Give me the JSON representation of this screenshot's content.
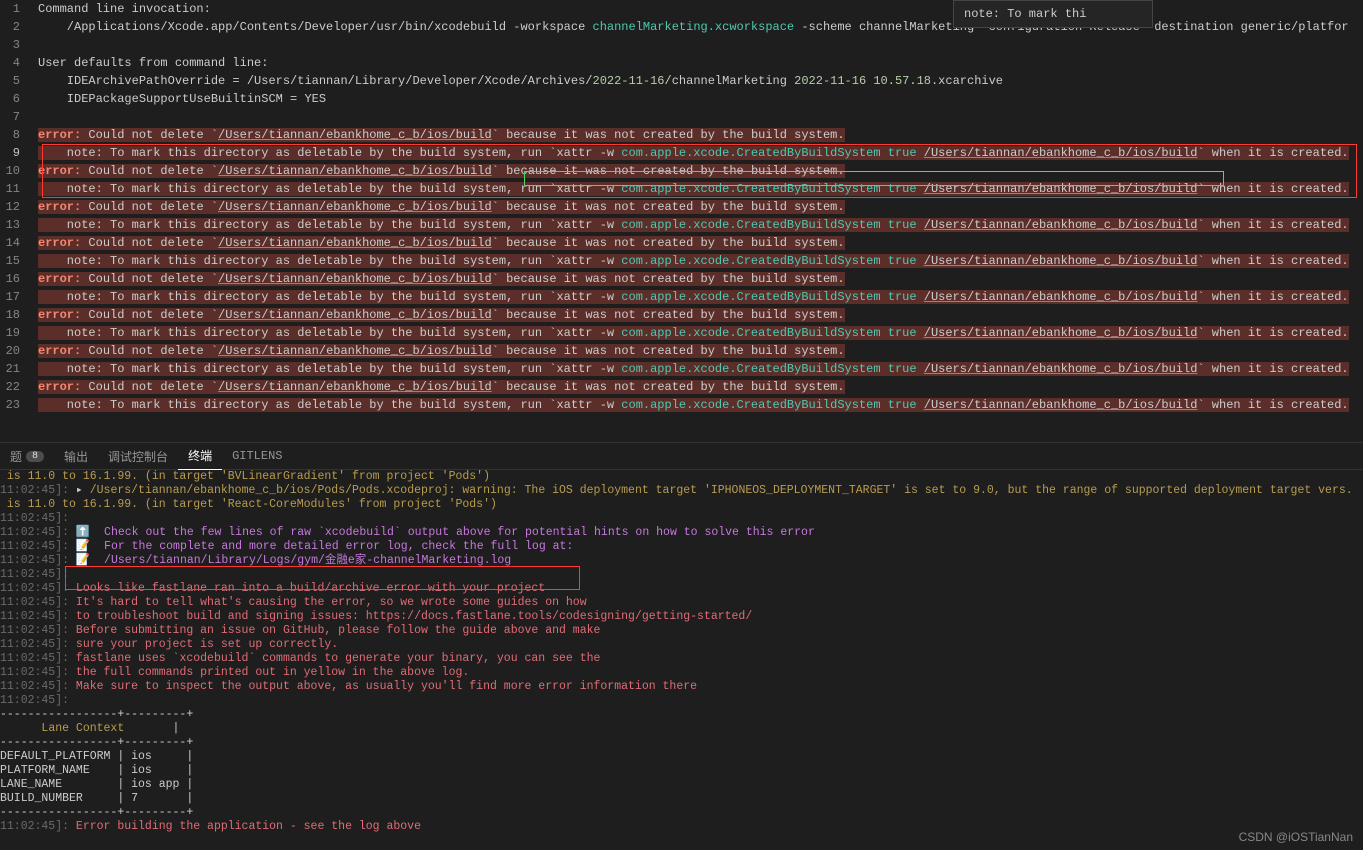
{
  "hover": {
    "text": "    note: To mark thi"
  },
  "editor": {
    "lines": [
      {
        "n": 1,
        "text": "Command line invocation:"
      },
      {
        "n": 2,
        "segs": [
          {
            "t": "    /Applications/Xcode.app/Contents/Developer/usr/bin/xcodebuild -workspace "
          },
          {
            "t": "channelMarketing.xcworkspace",
            "cls": "w-cyan"
          },
          {
            "t": " -scheme channelMarketing -configuration Release -destination generic/platfor"
          }
        ]
      },
      {
        "n": 3,
        "text": ""
      },
      {
        "n": 4,
        "text": "User defaults from command line:"
      },
      {
        "n": 5,
        "segs": [
          {
            "t": "    IDEArchivePathOverride = /Users/tiannan/Library/Developer/Xcode/Archives/"
          },
          {
            "t": "2022-11-16",
            "cls": "w-num"
          },
          {
            "t": "/channelMarketing "
          },
          {
            "t": "2022-11-16",
            "cls": "w-num"
          },
          {
            "t": " "
          },
          {
            "t": "10",
            "cls": "w-num"
          },
          {
            "t": "."
          },
          {
            "t": "57",
            "cls": "w-num"
          },
          {
            "t": "."
          },
          {
            "t": "18",
            "cls": "w-num"
          },
          {
            "t": ".xcarchive"
          }
        ]
      },
      {
        "n": 6,
        "text": "    IDEPackageSupportUseBuiltinSCM = YES"
      },
      {
        "n": 7,
        "text": ""
      },
      {
        "n": 8,
        "hl": true,
        "segs": [
          {
            "t": "error:",
            "cls": "err-word"
          },
          {
            "t": " Could not delete `"
          },
          {
            "t": "/Users/tiannan/ebankhome_c_b/ios/build",
            "cls": "underline"
          },
          {
            "t": "` because it was not created by the build system."
          }
        ]
      },
      {
        "n": 9,
        "active": true,
        "hl": true,
        "segs": [
          {
            "t": "    note: To mark this directory as deletable by the build system, run `xattr -w "
          },
          {
            "t": "com.apple.xcode.CreatedByBuildSystem true",
            "cls": "w-cyan"
          },
          {
            "t": " "
          },
          {
            "t": "/Users/tiannan/ebankhome_c_b/ios/build",
            "cls": "underline"
          },
          {
            "t": "` when it is created."
          }
        ]
      },
      {
        "n": 10,
        "hl": true,
        "segs": [
          {
            "t": "error:",
            "cls": "err-word"
          },
          {
            "t": " Could not delete `"
          },
          {
            "t": "/Users/tiannan/ebankhome_c_b/ios/build",
            "cls": "underline"
          },
          {
            "t": "` because it was not created by the build system."
          }
        ]
      },
      {
        "n": 11,
        "hl": true,
        "segs": [
          {
            "t": "    note: To mark this directory as deletable by the build system, run `xattr -w "
          },
          {
            "t": "com.apple.xcode.CreatedByBuildSystem true",
            "cls": "w-cyan"
          },
          {
            "t": " "
          },
          {
            "t": "/Users/tiannan/ebankhome_c_b/ios/build",
            "cls": "underline"
          },
          {
            "t": "` when it is created."
          }
        ]
      },
      {
        "n": 12,
        "hl": true,
        "segs": [
          {
            "t": "error:",
            "cls": "err-word"
          },
          {
            "t": " Could not delete `"
          },
          {
            "t": "/Users/tiannan/ebankhome_c_b/ios/build",
            "cls": "underline"
          },
          {
            "t": "` because it was not created by the build system."
          }
        ]
      },
      {
        "n": 13,
        "hl": true,
        "segs": [
          {
            "t": "    note: To mark this directory as deletable by the build system, run `xattr -w "
          },
          {
            "t": "com.apple.xcode.CreatedByBuildSystem true",
            "cls": "w-cyan"
          },
          {
            "t": " "
          },
          {
            "t": "/Users/tiannan/ebankhome_c_b/ios/build",
            "cls": "underline"
          },
          {
            "t": "` when it is created."
          }
        ]
      },
      {
        "n": 14,
        "hl": true,
        "segs": [
          {
            "t": "error:",
            "cls": "err-word"
          },
          {
            "t": " Could not delete `"
          },
          {
            "t": "/Users/tiannan/ebankhome_c_b/ios/build",
            "cls": "underline"
          },
          {
            "t": "` because it was not created by the build system."
          }
        ]
      },
      {
        "n": 15,
        "hl": true,
        "segs": [
          {
            "t": "    note: To mark this directory as deletable by the build system, run `xattr -w "
          },
          {
            "t": "com.apple.xcode.CreatedByBuildSystem true",
            "cls": "w-cyan"
          },
          {
            "t": " "
          },
          {
            "t": "/Users/tiannan/ebankhome_c_b/ios/build",
            "cls": "underline"
          },
          {
            "t": "` when it is created."
          }
        ]
      },
      {
        "n": 16,
        "hl": true,
        "segs": [
          {
            "t": "error:",
            "cls": "err-word"
          },
          {
            "t": " Could not delete `"
          },
          {
            "t": "/Users/tiannan/ebankhome_c_b/ios/build",
            "cls": "underline"
          },
          {
            "t": "` because it was not created by the build system."
          }
        ]
      },
      {
        "n": 17,
        "hl": true,
        "segs": [
          {
            "t": "    note: To mark this directory as deletable by the build system, run `xattr -w "
          },
          {
            "t": "com.apple.xcode.CreatedByBuildSystem true",
            "cls": "w-cyan"
          },
          {
            "t": " "
          },
          {
            "t": "/Users/tiannan/ebankhome_c_b/ios/build",
            "cls": "underline"
          },
          {
            "t": "` when it is created."
          }
        ]
      },
      {
        "n": 18,
        "hl": true,
        "segs": [
          {
            "t": "error:",
            "cls": "err-word"
          },
          {
            "t": " Could not delete `"
          },
          {
            "t": "/Users/tiannan/ebankhome_c_b/ios/build",
            "cls": "underline"
          },
          {
            "t": "` because it was not created by the build system."
          }
        ]
      },
      {
        "n": 19,
        "hl": true,
        "segs": [
          {
            "t": "    note: To mark this directory as deletable by the build system, run `xattr -w "
          },
          {
            "t": "com.apple.xcode.CreatedByBuildSystem true",
            "cls": "w-cyan"
          },
          {
            "t": " "
          },
          {
            "t": "/Users/tiannan/ebankhome_c_b/ios/build",
            "cls": "underline"
          },
          {
            "t": "` when it is created."
          }
        ]
      },
      {
        "n": 20,
        "hl": true,
        "segs": [
          {
            "t": "error:",
            "cls": "err-word"
          },
          {
            "t": " Could not delete `"
          },
          {
            "t": "/Users/tiannan/ebankhome_c_b/ios/build",
            "cls": "underline"
          },
          {
            "t": "` because it was not created by the build system."
          }
        ]
      },
      {
        "n": 21,
        "hl": true,
        "segs": [
          {
            "t": "    note: To mark this directory as deletable by the build system, run `xattr -w "
          },
          {
            "t": "com.apple.xcode.CreatedByBuildSystem true",
            "cls": "w-cyan"
          },
          {
            "t": " "
          },
          {
            "t": "/Users/tiannan/ebankhome_c_b/ios/build",
            "cls": "underline"
          },
          {
            "t": "` when it is created."
          }
        ]
      },
      {
        "n": 22,
        "hl": true,
        "segs": [
          {
            "t": "error:",
            "cls": "err-word"
          },
          {
            "t": " Could not delete `"
          },
          {
            "t": "/Users/tiannan/ebankhome_c_b/ios/build",
            "cls": "underline"
          },
          {
            "t": "` because it was not created by the build system."
          }
        ]
      },
      {
        "n": 23,
        "hl": true,
        "segs": [
          {
            "t": "    note: To mark this directory as deletable by the build system, run `xattr -w "
          },
          {
            "t": "com.apple.xcode.CreatedByBuildSystem true",
            "cls": "w-cyan"
          },
          {
            "t": " "
          },
          {
            "t": "/Users/tiannan/ebankhome_c_b/ios/build",
            "cls": "underline"
          },
          {
            "t": "` when it is created."
          }
        ]
      }
    ]
  },
  "tabs": {
    "problems": {
      "label": "题",
      "badge": "8"
    },
    "output": {
      "label": "输出"
    },
    "debug": {
      "label": "调试控制台"
    },
    "terminal": {
      "label": "终端"
    },
    "gitlens": {
      "label": "GITLENS"
    }
  },
  "terminal": {
    "lines": [
      {
        "segs": [
          {
            "t": " is 11.0 to 16.1.99. (in target 'BVLinearGradient' from project 'Pods')",
            "cls": "term-yellow"
          }
        ]
      },
      {
        "segs": [
          {
            "t": "11:02:45]: ",
            "cls": "term-gray"
          },
          {
            "t": "▸ ",
            "cls": "term-white"
          },
          {
            "t": "/Users/tiannan/ebankhome_c_b/ios/Pods/Pods.xcodeproj: warning: The iOS deployment target 'IPHONEOS_DEPLOYMENT_TARGET' is set to 9.0, but the range of supported deployment target vers.",
            "cls": "term-yellow"
          }
        ]
      },
      {
        "segs": [
          {
            "t": " is 11.0 to 16.1.99. (in target 'React-CoreModules' from project 'Pods')",
            "cls": "term-yellow"
          }
        ]
      },
      {
        "segs": [
          {
            "t": "11:02:45]:",
            "cls": "term-gray"
          }
        ]
      },
      {
        "segs": [
          {
            "t": "11:02:45]: ",
            "cls": "term-gray"
          },
          {
            "t": "⬆️  ",
            "cls": "term-white"
          },
          {
            "t": "Check out the few lines of raw `xcodebuild` output above for potential hints on how to solve this error",
            "cls": "term-pink"
          }
        ]
      },
      {
        "segs": [
          {
            "t": "11:02:45]: ",
            "cls": "term-gray"
          },
          {
            "t": "📝  ",
            "cls": "term-white"
          },
          {
            "t": "For the complete and more detailed error log, check the full log at:",
            "cls": "term-pink"
          }
        ]
      },
      {
        "segs": [
          {
            "t": "11:02:45]: ",
            "cls": "term-gray"
          },
          {
            "t": "📝  ",
            "cls": "term-white"
          },
          {
            "t": "/Users/tiannan/Library/Logs/gym/金融e家-channelMarketing.log",
            "cls": "term-pink"
          }
        ]
      },
      {
        "segs": [
          {
            "t": "11:02:45]:",
            "cls": "term-gray"
          }
        ]
      },
      {
        "segs": [
          {
            "t": "11:02:45]: ",
            "cls": "term-gray"
          },
          {
            "t": "Looks like fastlane ran into a build/archive error with your project",
            "cls": "term-red"
          }
        ]
      },
      {
        "segs": [
          {
            "t": "11:02:45]: ",
            "cls": "term-gray"
          },
          {
            "t": "It's hard to tell what's causing the error, so we wrote some guides on how",
            "cls": "term-red"
          }
        ]
      },
      {
        "segs": [
          {
            "t": "11:02:45]: ",
            "cls": "term-gray"
          },
          {
            "t": "to troubleshoot build and signing issues: https://docs.fastlane.tools/codesigning/getting-started/",
            "cls": "term-red"
          }
        ]
      },
      {
        "segs": [
          {
            "t": "11:02:45]: ",
            "cls": "term-gray"
          },
          {
            "t": "Before submitting an issue on GitHub, please follow the guide above and make",
            "cls": "term-red"
          }
        ]
      },
      {
        "segs": [
          {
            "t": "11:02:45]: ",
            "cls": "term-gray"
          },
          {
            "t": "sure your project is set up correctly.",
            "cls": "term-red"
          }
        ]
      },
      {
        "segs": [
          {
            "t": "11:02:45]: ",
            "cls": "term-gray"
          },
          {
            "t": "fastlane uses `xcodebuild` commands to generate your binary, you can see the",
            "cls": "term-red"
          }
        ]
      },
      {
        "segs": [
          {
            "t": "11:02:45]: ",
            "cls": "term-gray"
          },
          {
            "t": "the full commands printed out in yellow in the above log.",
            "cls": "term-red"
          }
        ]
      },
      {
        "segs": [
          {
            "t": "11:02:45]: ",
            "cls": "term-gray"
          },
          {
            "t": "Make sure to inspect the output above, as usually you'll find more error information there",
            "cls": "term-red"
          }
        ]
      },
      {
        "segs": [
          {
            "t": "11:02:45]:",
            "cls": "term-gray"
          }
        ]
      },
      {
        "segs": [
          {
            "t": "-----------------+---------+",
            "cls": "term-white"
          }
        ]
      },
      {
        "segs": [
          {
            "t": "      ",
            "cls": "term-white"
          },
          {
            "t": "Lane Context",
            "cls": "term-yellow"
          },
          {
            "t": "       |",
            "cls": "term-white"
          }
        ]
      },
      {
        "segs": [
          {
            "t": "-----------------+---------+",
            "cls": "term-white"
          }
        ]
      },
      {
        "segs": [
          {
            "t": "DEFAULT_PLATFORM | ios     |",
            "cls": "term-white"
          }
        ]
      },
      {
        "segs": [
          {
            "t": "PLATFORM_NAME    | ios     |",
            "cls": "term-white"
          }
        ]
      },
      {
        "segs": [
          {
            "t": "LANE_NAME        | ios app |",
            "cls": "term-white"
          }
        ]
      },
      {
        "segs": [
          {
            "t": "BUILD_NUMBER     | 7       |",
            "cls": "term-white"
          }
        ]
      },
      {
        "segs": [
          {
            "t": "-----------------+---------+",
            "cls": "term-white"
          }
        ]
      },
      {
        "segs": [
          {
            "t": "",
            "cls": "term-white"
          }
        ]
      },
      {
        "segs": [
          {
            "t": "11:02:45]: ",
            "cls": "term-gray"
          },
          {
            "t": "Error building the application - see the log above",
            "cls": "term-red"
          }
        ]
      }
    ]
  },
  "watermark": "CSDN @iOSTianNan"
}
